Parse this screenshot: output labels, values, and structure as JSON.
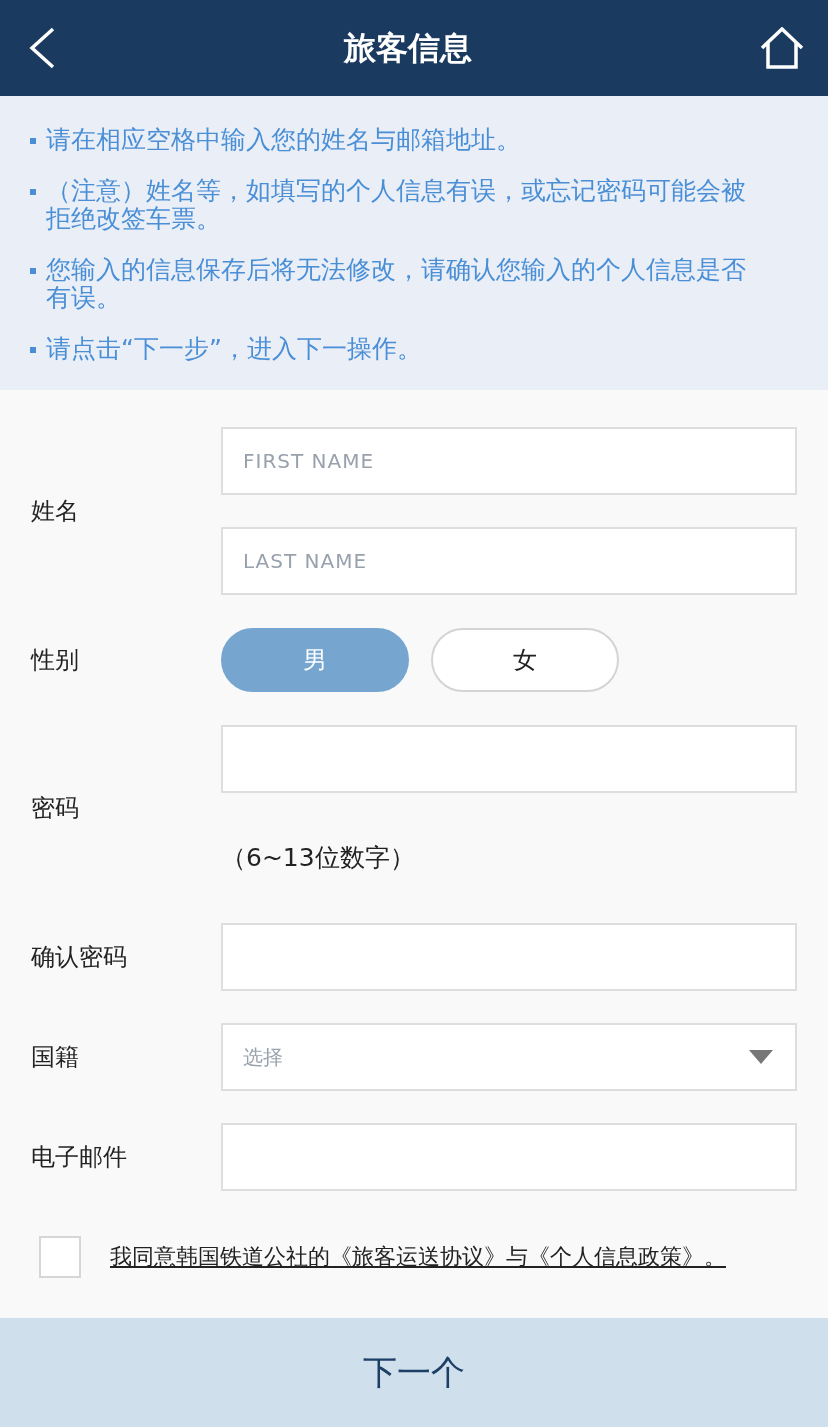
{
  "header": {
    "title": "旅客信息"
  },
  "notices": [
    "请在相应空格中输入您的姓名与邮箱地址。",
    "（注意）姓名等，如填写的个人信息有误，或忘记密码可能会被拒绝改签车票。",
    "您输入的信息保存后将无法修改，请确认您输入的个人信息是否有误。",
    "请点击“下一步”，进入下一操作。"
  ],
  "form": {
    "fields": [
      {
        "kind": "name",
        "label": "姓名",
        "inputs": [
          {
            "placeholder": "FIRST NAME"
          },
          {
            "placeholder": "LAST NAME"
          }
        ]
      },
      {
        "kind": "choice",
        "label": "性别",
        "options": [
          {
            "label": "男",
            "selected": true
          },
          {
            "label": "女",
            "selected": false
          }
        ]
      },
      {
        "kind": "text",
        "label": "密码",
        "hint": "（6~13位数字）"
      },
      {
        "kind": "text",
        "label": "确认密码"
      },
      {
        "kind": "select",
        "label": "国籍",
        "placeholder": "选择"
      },
      {
        "kind": "text",
        "label": "电子邮件"
      }
    ]
  },
  "agreement": {
    "checked": false,
    "text": "我同意韩国铁道公社的《旅客运送协议》与《个人信息政策》。"
  },
  "next_button": {
    "label": "下一个"
  }
}
